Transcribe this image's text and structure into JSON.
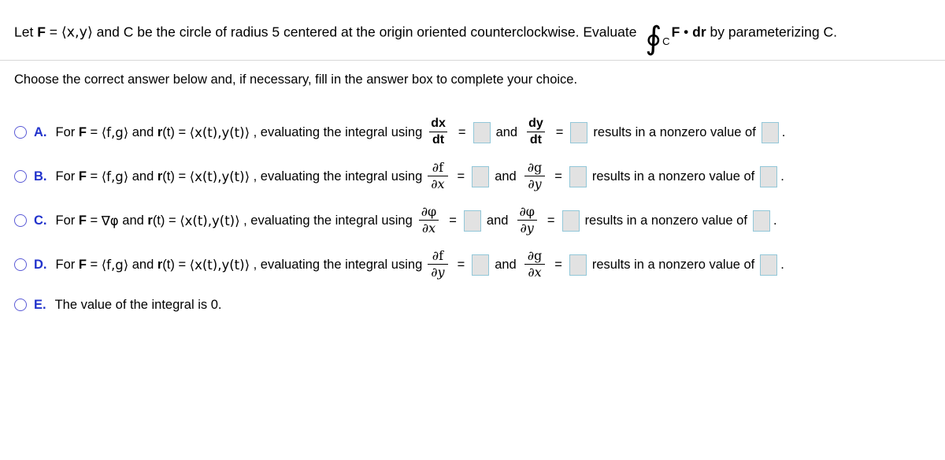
{
  "problem": {
    "stem_parts": {
      "p1": "Let ",
      "F": "F",
      "p2": " = ",
      "vec_xy": "⟨x,y⟩",
      "p3": " and C be the circle of radius 5 centered at the origin oriented counterclockwise. Evaluate ",
      "integral_symbol": "∮",
      "integral_subscript": "C",
      "F2": "F",
      "dot": " • ",
      "dr": "dr",
      "p4": " by parameterizing C."
    },
    "instruction": "Choose the correct answer below and, if necessary, fill in the answer box to complete your choice."
  },
  "colors": {
    "radio_border": "#5b5bd6",
    "letter_blue": "#2233cc",
    "answerbox_border": "#92c7d8",
    "answerbox_fill": "#e2e2e2",
    "divider": "#d8d8d8"
  },
  "choices": [
    {
      "id": "A",
      "letter": "A.",
      "selected": false,
      "lead": "For ",
      "bold_F": "F",
      "eq1": " = ",
      "field": "⟨f,g⟩",
      "mid": " and ",
      "bold_r": "r",
      "r_arg": "(t) = ",
      "r_field": "⟨x(t),y(t)⟩",
      "tail": " , evaluating the integral using",
      "frac1": {
        "num": "dx",
        "den": "dt"
      },
      "eq_sign1": "=",
      "box1": "",
      "and": "and",
      "frac2": {
        "num": "dy",
        "den": "dt"
      },
      "eq_sign2": "=",
      "box2": "",
      "result_text": "results in a nonzero value of",
      "box3": "",
      "period": "."
    },
    {
      "id": "B",
      "letter": "B.",
      "selected": false,
      "lead": "For ",
      "bold_F": "F",
      "eq1": " = ",
      "field": "⟨f,g⟩",
      "mid": " and ",
      "bold_r": "r",
      "r_arg": "(t) = ",
      "r_field": "⟨x(t),y(t)⟩",
      "tail": " , evaluating the integral using",
      "frac1": {
        "num": "∂f",
        "den": "∂x"
      },
      "eq_sign1": "=",
      "box1": "",
      "and": "and",
      "frac2": {
        "num": "∂g",
        "den": "∂y"
      },
      "eq_sign2": "=",
      "box2": "",
      "result_text": "results in a nonzero value of",
      "box3": "",
      "period": "."
    },
    {
      "id": "C",
      "letter": "C.",
      "selected": false,
      "lead": "For ",
      "bold_F": "F",
      "eq1": " = ",
      "field": "∇φ",
      "mid": " and ",
      "bold_r": "r",
      "r_arg": "(t) = ",
      "r_field": "⟨x(t),y(t)⟩",
      "tail": " , evaluating the integral using",
      "frac1": {
        "num": "∂φ",
        "den": "∂x"
      },
      "eq_sign1": "=",
      "box1": "",
      "and": "and",
      "frac2": {
        "num": "∂φ",
        "den": "∂y"
      },
      "eq_sign2": "=",
      "box2": "",
      "result_text": "results in a nonzero value of",
      "box3": "",
      "period": "."
    },
    {
      "id": "D",
      "letter": "D.",
      "selected": false,
      "lead": "For ",
      "bold_F": "F",
      "eq1": " = ",
      "field": "⟨f,g⟩",
      "mid": " and ",
      "bold_r": "r",
      "r_arg": "(t) = ",
      "r_field": "⟨x(t),y(t)⟩",
      "tail": " , evaluating the integral using",
      "frac1": {
        "num": "∂f",
        "den": "∂y"
      },
      "eq_sign1": "=",
      "box1": "",
      "and": "and",
      "frac2": {
        "num": "∂g",
        "den": "∂x"
      },
      "eq_sign2": "=",
      "box2": "",
      "result_text": "results in a nonzero value of",
      "box3": "",
      "period": "."
    },
    {
      "id": "E",
      "letter": "E.",
      "selected": false,
      "text": "The value of the integral is 0."
    }
  ]
}
